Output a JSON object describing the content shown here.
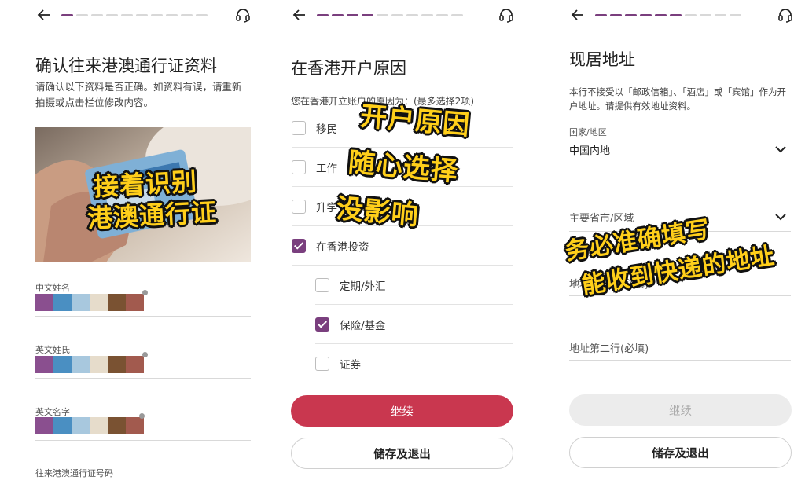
{
  "screens": [
    {
      "title": "确认往来港澳通行证资料",
      "description": "请确认以下资料是否正确。如资料有误，请重新拍摄或点击栏位修改内容。",
      "overlay": [
        "接着识别",
        "港澳通行证"
      ],
      "fields": [
        {
          "label": "中文姓名"
        },
        {
          "label": "英文姓氏"
        },
        {
          "label": "英文名字"
        },
        {
          "label": "往来港澳通行证号码"
        }
      ],
      "mask_colors": [
        "#8a4f8f",
        "#4a8fc2",
        "#a8c8de",
        "#e6dccb",
        "#7a5232",
        "#a25a4e"
      ]
    },
    {
      "title": "在香港开户原因",
      "prompt": "您在香港开立账户的原因为：(最多选择2项)",
      "overlay": [
        "开户原因",
        "随心选择",
        "没影响"
      ],
      "options": [
        {
          "label": "移民",
          "checked": false
        },
        {
          "label": "工作",
          "checked": false
        },
        {
          "label": "升学",
          "checked": false
        },
        {
          "label": "在香港投资",
          "checked": true
        }
      ],
      "sub_options": [
        {
          "label": "定期/外汇",
          "checked": false
        },
        {
          "label": "保险/基金",
          "checked": true
        },
        {
          "label": "证券",
          "checked": false
        }
      ],
      "continue_label": "继续",
      "save_exit_label": "储存及退出"
    },
    {
      "title": "现居地址",
      "description": "本行不接受以「邮政信箱」、「酒店」或「宾馆」作为开户地址。请提供有效地址资料。",
      "overlay": [
        "务必准确填写",
        "能收到快递的地址"
      ],
      "country_label": "国家/地区",
      "country_value": "中国内地",
      "province_placeholder": "主要省市/区域",
      "address_line1_placeholder": "地址第一行(必填)",
      "address_line2_placeholder": "地址第二行(必填)",
      "continue_label": "继续",
      "save_exit_label": "储存及退出"
    }
  ],
  "colors": {
    "accent_purple": "#7a3f7e",
    "primary_red": "#c9374f",
    "overlay_yellow": "#ffcf1a"
  },
  "icons": [
    "back-arrow-icon",
    "headset-icon",
    "chevron-down-icon",
    "checkmark-icon"
  ]
}
